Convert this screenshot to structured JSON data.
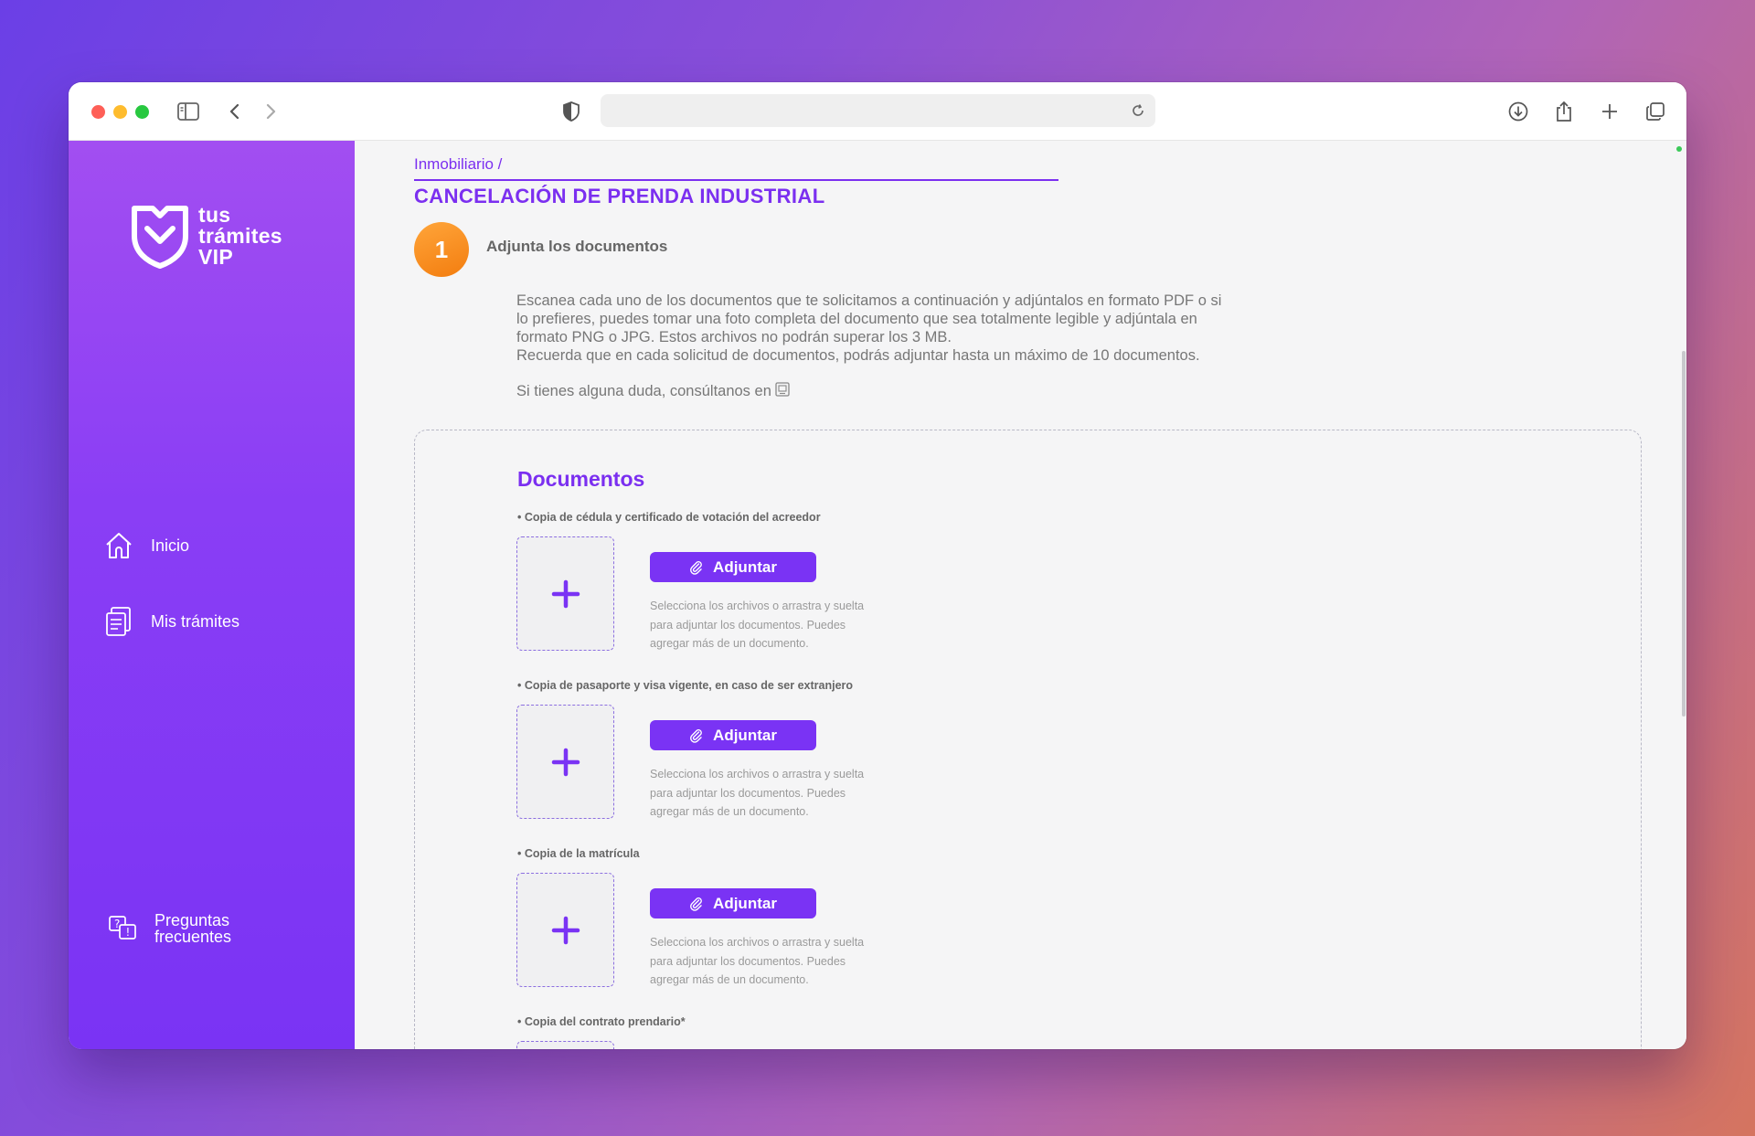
{
  "browser": {
    "icons": {
      "sidebar": "sidebar-toggle-icon",
      "back": "chevron-left-icon",
      "forward": "chevron-right-icon",
      "shield": "shield-icon",
      "reload": "reload-icon",
      "download": "download-icon",
      "share": "share-icon",
      "new_tab": "plus-icon",
      "tabs": "tabs-overview-icon"
    },
    "url": ""
  },
  "sidebar": {
    "logo": {
      "line1": "tus",
      "line2": "trámites",
      "line3": "VIP"
    },
    "nav": [
      {
        "label": "Inicio",
        "icon": "home-icon"
      },
      {
        "label": "Mis trámites",
        "icon": "documents-icon"
      }
    ],
    "faq": {
      "line1": "Preguntas",
      "line2": "frecuentes",
      "icon": "faq-icon"
    }
  },
  "main": {
    "breadcrumb": "Inmobiliario /",
    "title": "CANCELACIÓN DE PRENDA INDUSTRIAL",
    "step": {
      "number": "1",
      "label": "Adjunta los documentos"
    },
    "intro": {
      "line1": "Escanea cada uno de los documentos que te solicitamos a continuación y adjúntalos en formato PDF o si",
      "line2": "lo prefieres, puedes tomar una foto completa del documento que sea totalmente legible y adjúntala en",
      "line3": "formato PNG o JPG. Estos archivos no podrán superar los 3 MB.",
      "line4": "Recuerda que en cada solicitud de documentos, podrás adjuntar hasta un máximo de 10 documentos."
    },
    "doubt_text": "Si tienes alguna duda, consúltanos en",
    "documents": {
      "title": "Documentos",
      "attach_label": "Adjuntar",
      "hint_line1": "Selecciona los archivos o arrastra y suelta",
      "hint_line2": "para adjuntar los documentos. Puedes",
      "hint_line3": "agregar más de un documento.",
      "items": [
        {
          "label": "• Copia de cédula y certificado de votación del acreedor"
        },
        {
          "label": "• Copia de pasaporte y visa vigente, en caso de ser extranjero"
        },
        {
          "label": "• Copia de la matrícula"
        },
        {
          "label": "• Copia del contrato prendario*"
        }
      ]
    }
  },
  "colors": {
    "accent": "#7a33f4",
    "step": "#f58a1f"
  }
}
